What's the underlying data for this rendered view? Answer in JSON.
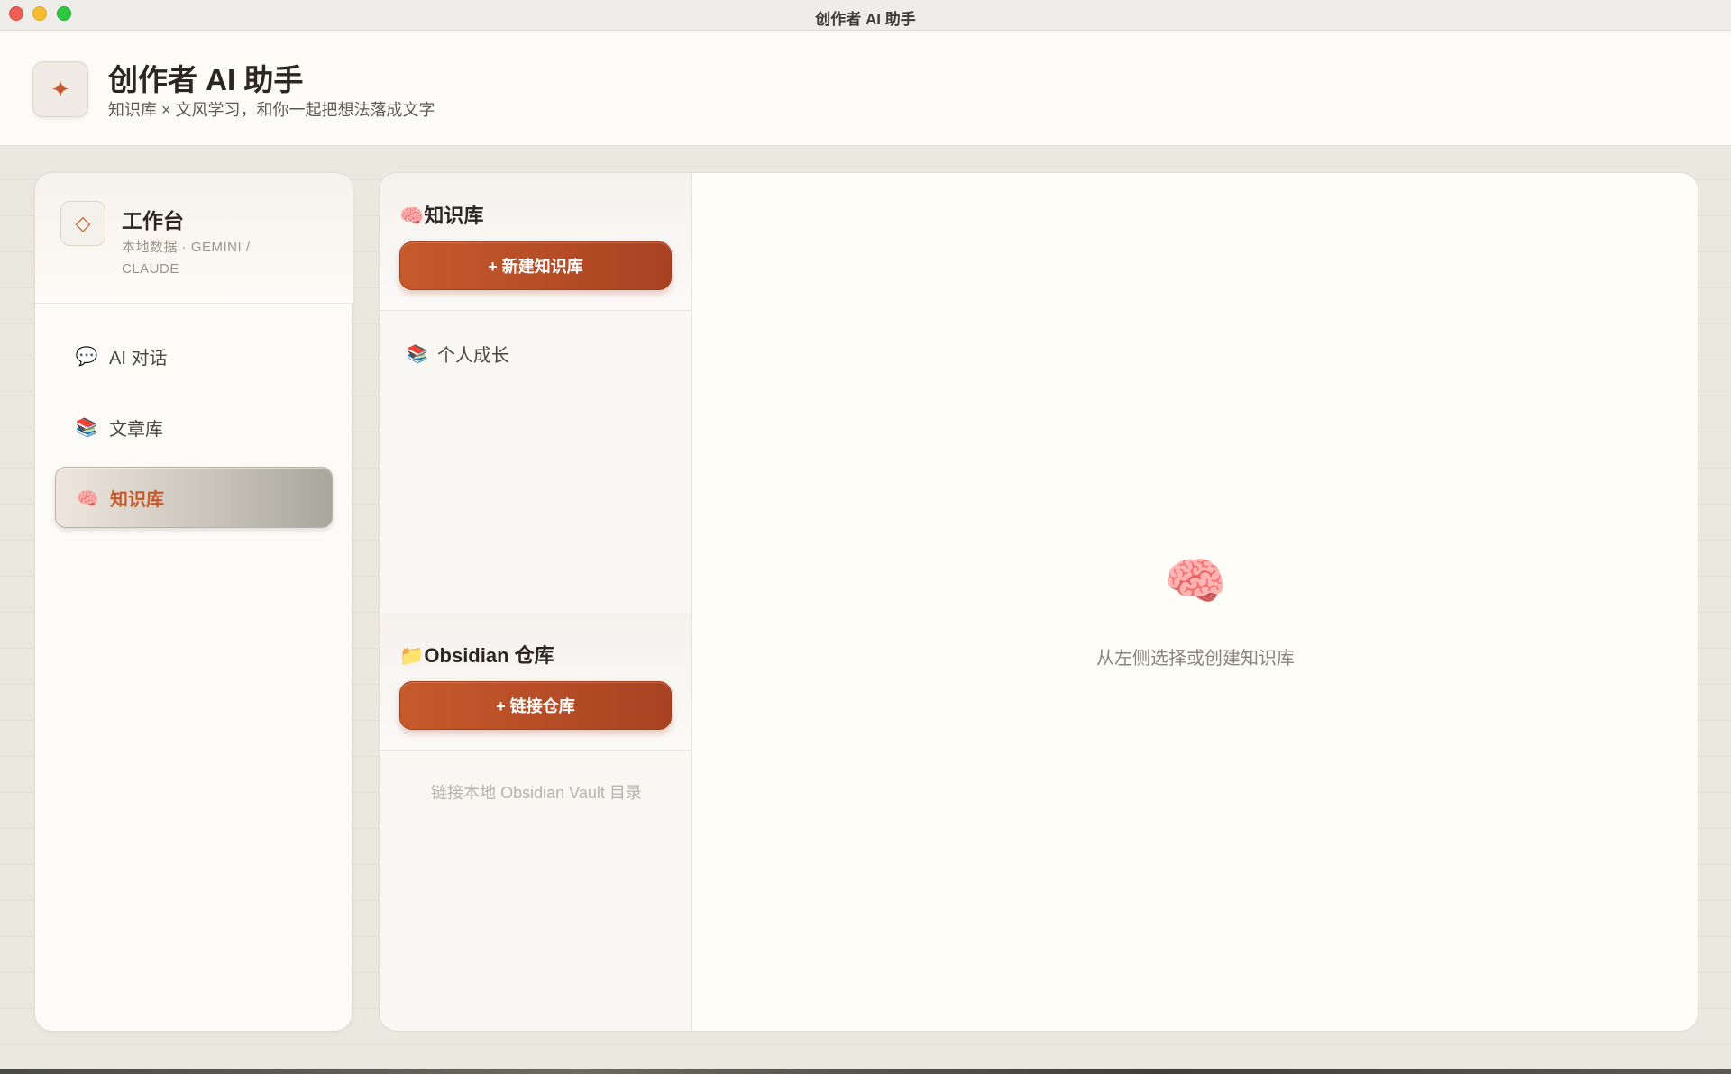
{
  "window": {
    "title": "创作者 AI 助手"
  },
  "header": {
    "logo_icon": "sparkle-icon",
    "title": "创作者 AI 助手",
    "subtitle": "知识库 × 文风学习，和你一起把想法落成文字"
  },
  "sidebar": {
    "workspace": {
      "icon": "diamond-icon",
      "title": "工作台",
      "subtitle": "本地数据 · GEMINI / CLAUDE"
    },
    "items": [
      {
        "label": "AI 对话",
        "icon": "speech-bubble-icon",
        "glyph": "💬",
        "active": false
      },
      {
        "label": "文章库",
        "icon": "books-icon",
        "glyph": "📚",
        "active": false
      },
      {
        "label": "知识库",
        "icon": "brain-icon",
        "glyph": "🧠",
        "active": true
      }
    ]
  },
  "knowledge": {
    "title_icon": "🧠",
    "title": "知识库",
    "new_button": "+ 新建知识库",
    "items": [
      {
        "label": "个人成长",
        "icon": "books-icon",
        "glyph": "📚"
      }
    ]
  },
  "obsidian": {
    "title_icon": "📁",
    "title": "Obsidian 仓库",
    "link_button": "+ 链接仓库",
    "hint": "链接本地 Obsidian Vault 目录"
  },
  "main": {
    "empty_icon": "🧠",
    "empty_text": "从左侧选择或创建知识库"
  },
  "colors": {
    "accent": "#c45a2e",
    "button": "#b84d27",
    "background": "#ebe8e0"
  }
}
